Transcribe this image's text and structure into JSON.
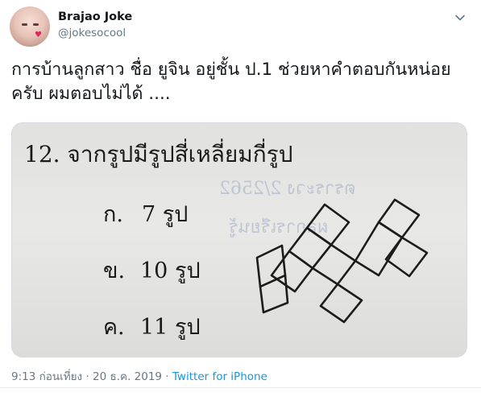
{
  "user": {
    "display_name": "Brajao Joke",
    "handle": "@jokesocool"
  },
  "tweet": {
    "text_line1": "การบ้านลูกสาว ชื่อ ยูจิน อยู่ชั้น ป.1 ช่วยหาคำตอบกันหน่อย",
    "text_line2": "ครับ ผมตอบไม่ได้ ...."
  },
  "photo": {
    "question": "12. จากรูปมีรูปสี่เหลี่ยมกี่รูป",
    "choices": [
      {
        "letter": "ก.",
        "answer": "7 รูป"
      },
      {
        "letter": "ข.",
        "answer": "10 รูป"
      },
      {
        "letter": "ค.",
        "answer": "11 รูป"
      }
    ],
    "bleed_text_1": "ตราระวง 2/2562",
    "bleed_text_2": "ผลการเรียนรู้"
  },
  "meta": {
    "time": "9:13 ก่อนเที่ยง",
    "separator": "·",
    "date": "20 ธ.ค. 2019",
    "source": "Twitter for iPhone"
  },
  "icons": {
    "more": "chevron-down-icon",
    "avatar_decoration": "heart-icon"
  },
  "colors": {
    "link": "#1b95e0",
    "secondary_text": "#657786",
    "primary_text": "#14171a"
  }
}
